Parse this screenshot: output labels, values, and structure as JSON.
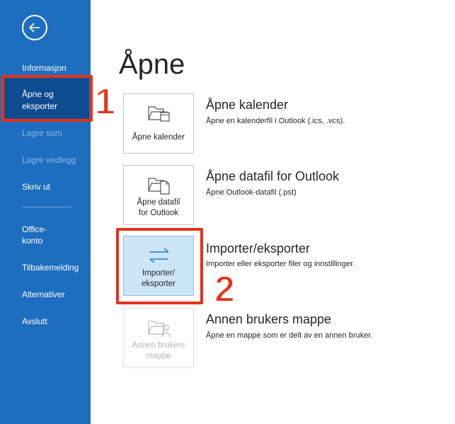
{
  "sidebar": {
    "back_icon": "arrow-left-circle-icon",
    "items": [
      {
        "label": "Informasjon",
        "enabled": true
      },
      {
        "label": "Åpne og\neksporter",
        "enabled": true,
        "active": true
      },
      {
        "label": "Lagre som",
        "enabled": false
      },
      {
        "label": "Lagre vedlegg",
        "enabled": false
      },
      {
        "label": "Skriv ut",
        "enabled": true
      },
      {
        "label": "Office-\nkonto",
        "enabled": true
      },
      {
        "label": "Tilbakemelding",
        "enabled": true
      },
      {
        "label": "Alternativer",
        "enabled": true
      },
      {
        "label": "Avslutt",
        "enabled": true
      }
    ]
  },
  "callouts": {
    "one": "1",
    "two": "2"
  },
  "main": {
    "title": "Åpne",
    "options": [
      {
        "tile_label": "Åpne kalender",
        "title": "Åpne kalender",
        "description": "Åpne en kalenderfil i Outlook (.ics, .vcs).",
        "icon": "open-calendar-icon"
      },
      {
        "tile_label": "Åpne datafil\nfor Outlook",
        "title": "Åpne datafil for Outlook",
        "description": "Åpne Outlook-datafil (.pst)",
        "icon": "open-data-file-icon"
      },
      {
        "tile_label": "Importer/\neksporter",
        "title": "Importer/eksporter",
        "description": "Importer eller eksporter filer og innstillinger.",
        "icon": "import-export-arrows-icon",
        "selected": true
      },
      {
        "tile_label": "Annen brukers\nmappe",
        "title": "Annen brukers mappe",
        "description": "Åpne en mappe som er delt av en annen bruker.",
        "icon": "shared-folder-icon",
        "disabled": true
      }
    ]
  },
  "colors": {
    "sidebar": "#1e6ebf",
    "accent_red": "#e8311a",
    "selected_tile": "#cde6f7"
  }
}
